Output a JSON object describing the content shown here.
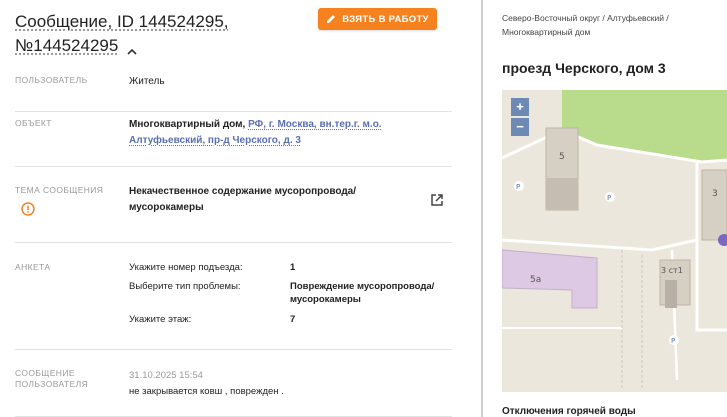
{
  "header": {
    "title_line1": "Сообщение, ID 144524295,",
    "title_line2": "№144524295",
    "take_button": "ВЗЯТЬ В РАБОТУ"
  },
  "fields": {
    "user_label": "ПОЛЬЗОВАТЕЛЬ",
    "user_value": "Житель",
    "object_label": "ОБЪЕКТ",
    "object_prefix": "Многоквартирный дом,",
    "object_link_1": "РФ, г. Москва, вн.тер.г. м.о.",
    "object_link_2": "Алтуфьевский, пр-д Черского, д. 3",
    "topic_label": "ТЕМА СООБЩЕНИЯ",
    "topic_line1": "Некачественное содержание мусоропровода/",
    "topic_line2": "мусорокамеры",
    "survey_label": "АНКЕТА",
    "q1": "Укажите номер подъезда:",
    "a1": "1",
    "q2": "Выберите тип проблемы:",
    "a2_line1": "Повреждение мусоропровода/",
    "a2_line2": "мусорокамеры",
    "q3": "Укажите этаж:",
    "a3": "7",
    "message_label_1": "СООБЩЕНИЕ",
    "message_label_2": "ПОЛЬЗОВАТЕЛЯ",
    "message_date": "31.10.2025 15:54",
    "message_text": "не закрывается ковш , поврежден ."
  },
  "right": {
    "breadcrumb_1": "Северо-Восточный округ / Алтуфьевский /",
    "breadcrumb_2": "Многоквартирный дом",
    "address": "проезд Черского, дом 3",
    "map": {
      "zoom_in": "+",
      "zoom_out": "−",
      "label_5": "5",
      "label_5a": "5а",
      "label_3st1": "3 ст1",
      "label_3": "3",
      "parking": "P"
    },
    "bottom_text": "Отключения горячей воды"
  },
  "colors": {
    "accent": "#f5821f",
    "link": "#5a6fb0",
    "warning": "#f5821f",
    "map_green": "#b9dc8c",
    "map_building": "#d6d0c4",
    "map_purple": "#ddc9e3"
  },
  "icons": [
    "chevron-up-icon",
    "pencil-icon",
    "warning-circle-icon",
    "external-link-icon",
    "zoom-in-icon",
    "zoom-out-icon"
  ]
}
